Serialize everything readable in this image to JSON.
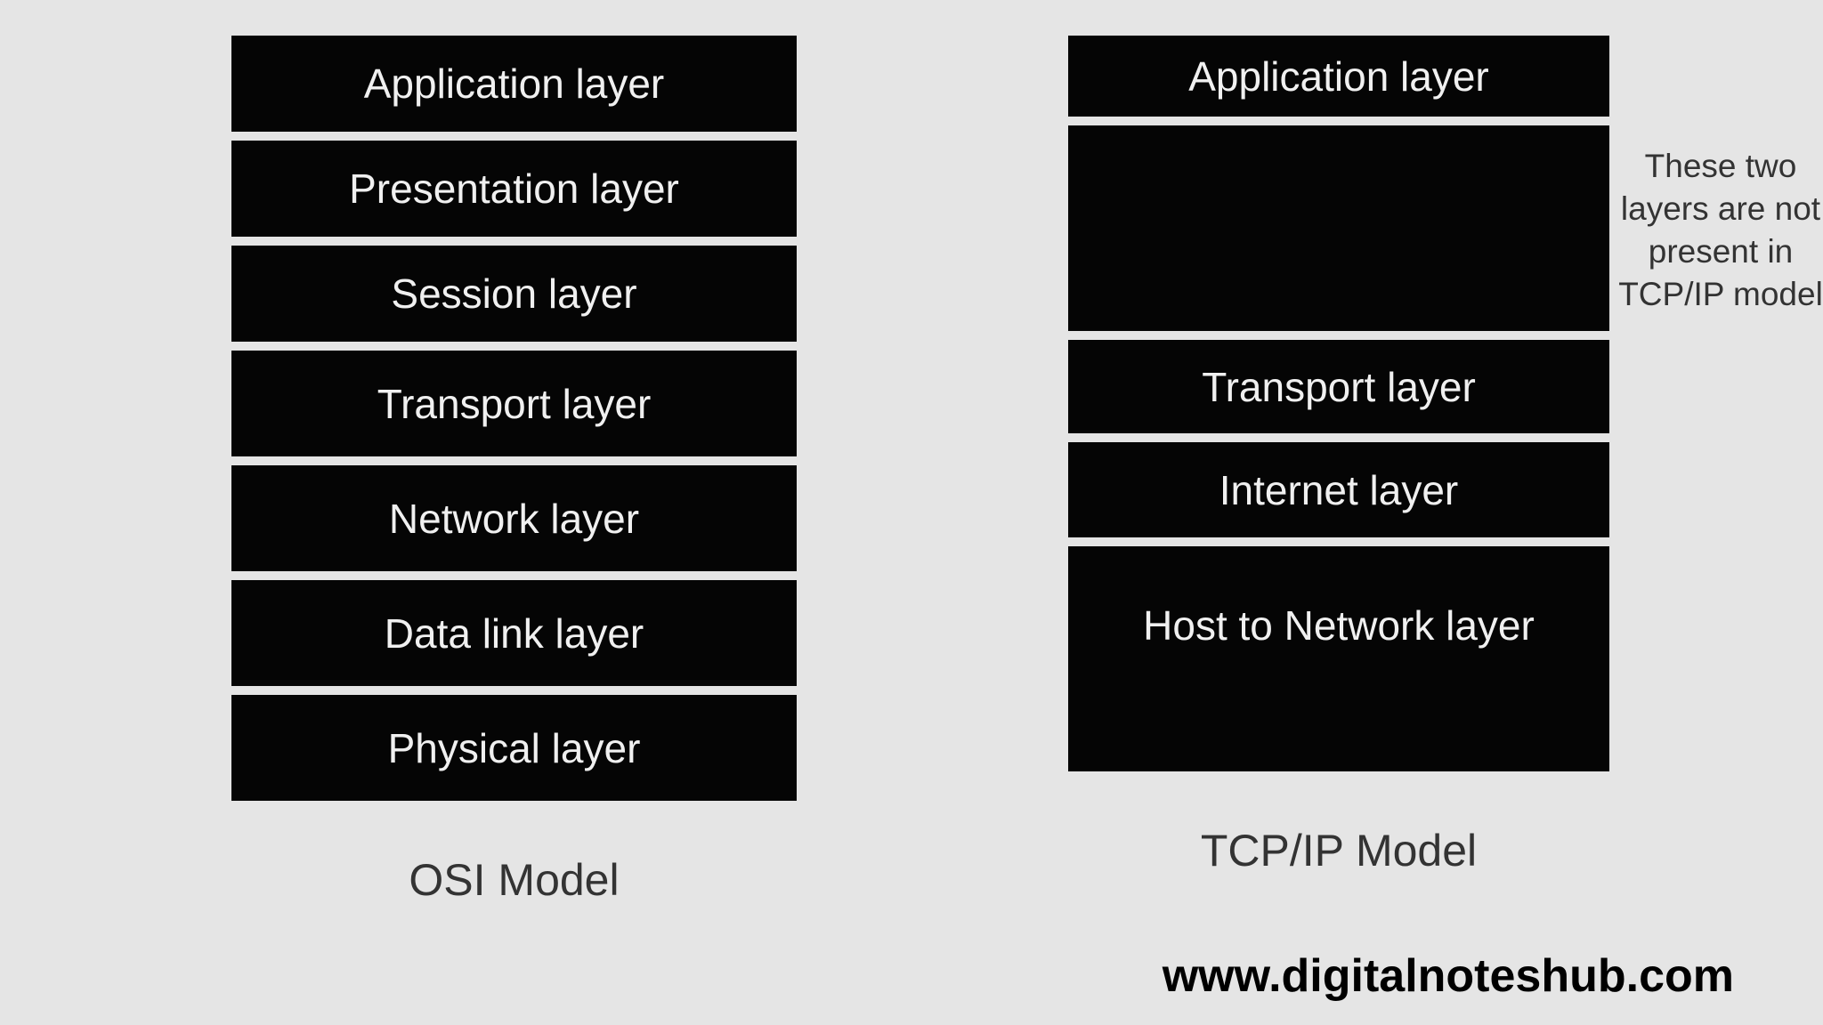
{
  "osi": {
    "title": "OSI Model",
    "layers": [
      "Application layer",
      "Presentation layer",
      "Session layer",
      "Transport layer",
      "Network layer",
      "Data link layer",
      "Physical layer"
    ]
  },
  "tcpip": {
    "title": "TCP/IP Model",
    "layers": [
      "Application layer",
      "",
      "Transport layer",
      "Internet layer",
      "Host to Network layer"
    ]
  },
  "side_note": "These two layers are not present in TCP/IP model",
  "footer_url": "www.digitalnoteshub.com"
}
